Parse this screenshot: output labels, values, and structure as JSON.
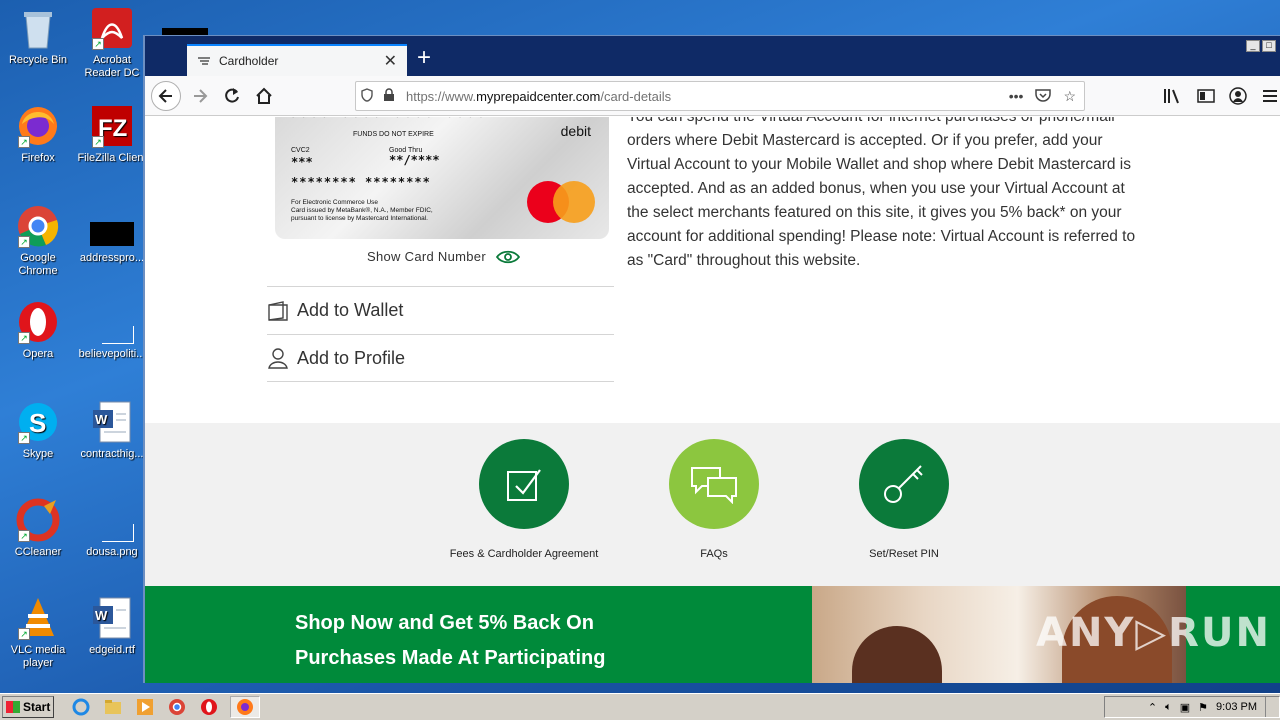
{
  "desktop": {
    "icons": [
      {
        "label": "Recycle Bin"
      },
      {
        "label": "Acrobat Reader DC"
      },
      {
        "label": "Firefox"
      },
      {
        "label": "FileZilla Client"
      },
      {
        "label": "Google Chrome"
      },
      {
        "label": "addresspro..."
      },
      {
        "label": "Opera"
      },
      {
        "label": "believepoliti..."
      },
      {
        "label": "Skype"
      },
      {
        "label": "contracthig..."
      },
      {
        "label": "CCleaner"
      },
      {
        "label": "dousa.png"
      },
      {
        "label": "VLC media player"
      },
      {
        "label": "edgeid.rtf"
      }
    ]
  },
  "browser": {
    "tab_title": "Cardholder",
    "url_prefix": "https://www.",
    "url_domain": "myprepaidcenter.com",
    "url_path": "/card-details"
  },
  "card": {
    "number_masked": "**** **** **** ****",
    "funds_text": "FUNDS DO NOT EXPIRE",
    "type": "debit",
    "cvc_label": "CVC2",
    "cvc_value": "***",
    "good_thru_label": "Good Thru",
    "good_thru_value": "**/****",
    "name_masked": "******** ********",
    "fine_print_1": "For Electronic Commerce Use",
    "fine_print_2": "Card issued by MetaBank®, N.A., Member FDIC,",
    "fine_print_3": "pursuant to license by Mastercard International."
  },
  "show_card_number": "Show Card Number",
  "actions": {
    "add_wallet": "Add to Wallet",
    "add_profile": "Add to Profile"
  },
  "description": "You can spend the Virtual Account for internet purchases or phone/mail orders where Debit Mastercard is accepted. Or if you prefer, add your Virtual Account to your Mobile Wallet and shop where Debit Mastercard is accepted. And as an added bonus, when you use your Virtual Account at the select merchants featured on this site, it gives you 5% back* on your account for additional spending! Please note: Virtual Account is referred to as \"Card\" throughout this website.",
  "links": {
    "fees": "Fees & Cardholder Agreement",
    "faqs": "FAQs",
    "pin": "Set/Reset PIN"
  },
  "banner": {
    "line1": "Shop Now and Get 5% Back On",
    "line2": "Purchases Made At Participating"
  },
  "watermark": "ANY.RUN",
  "taskbar": {
    "start": "Start",
    "clock": "9:03 PM"
  },
  "colors": {
    "dark_green": "#0b7a3a",
    "light_green": "#8cc63f",
    "banner_green": "#008a3a"
  }
}
